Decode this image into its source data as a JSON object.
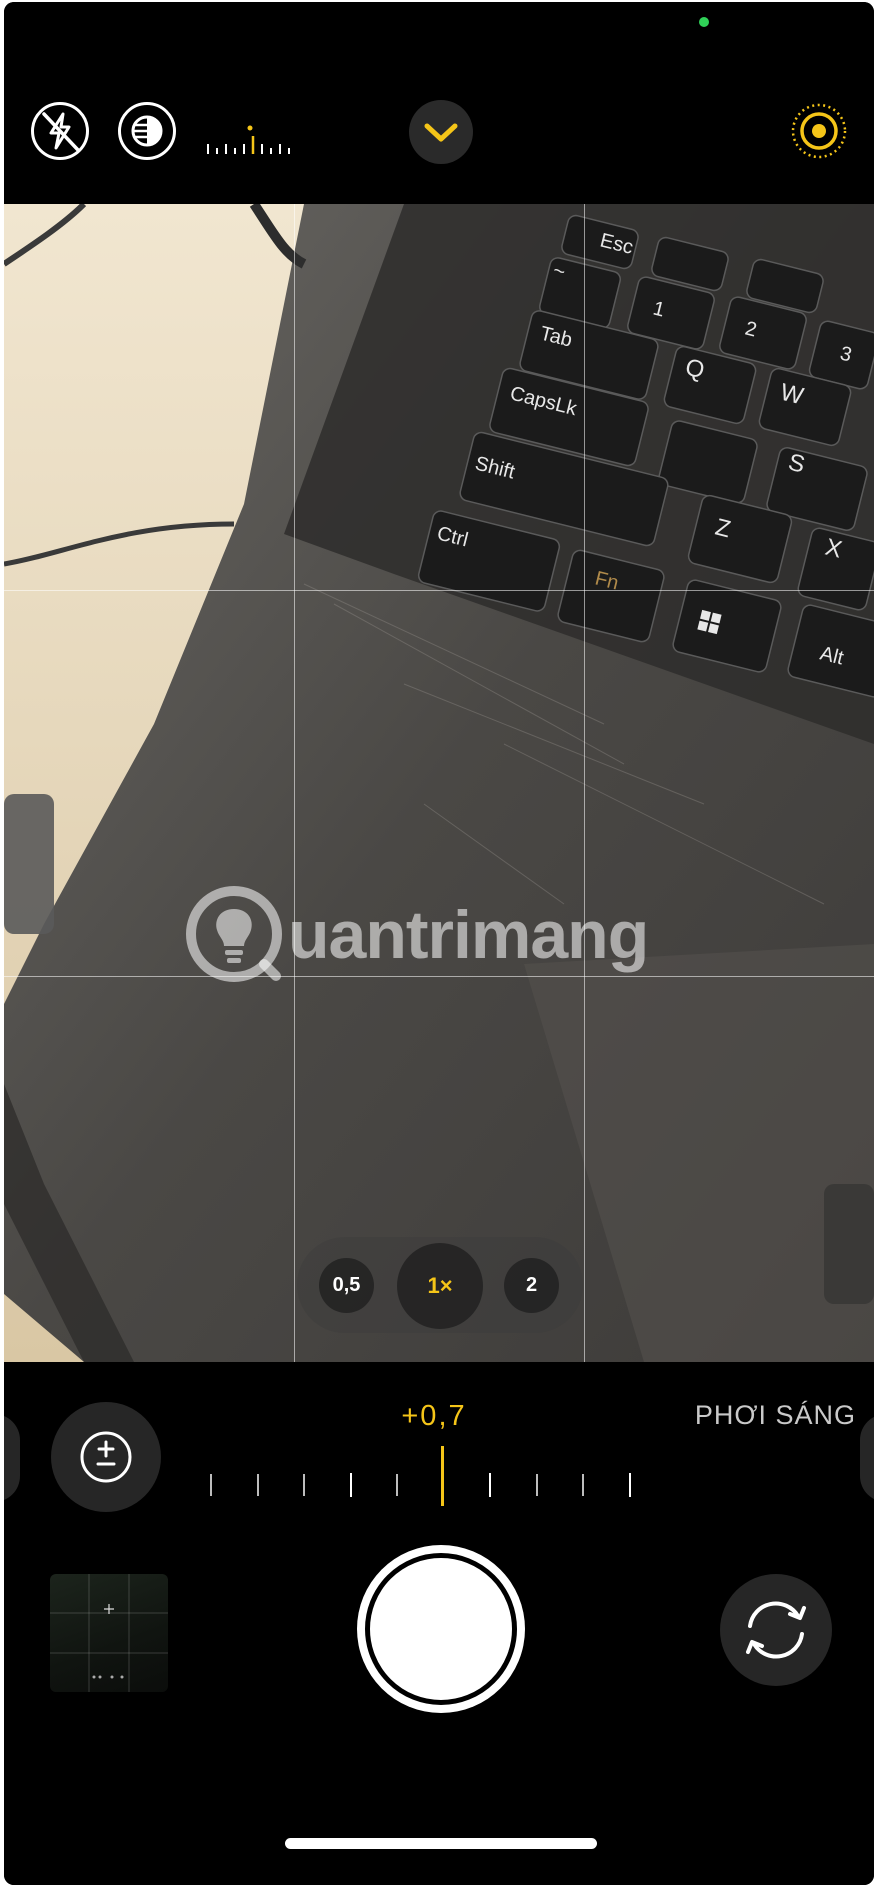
{
  "top_bar": {
    "flash_icon": "flash-off-icon",
    "night_icon": "night-mode-icon",
    "chevron_icon": "chevron-down-icon",
    "live_icon": "live-photo-icon",
    "accent_color": "#f5c518"
  },
  "viewfinder": {
    "watermark_text": "uantrimang",
    "zoom": {
      "options": [
        "0,5",
        "1×",
        "2"
      ],
      "selected": "1×"
    },
    "keyboard_keys": [
      "Esc",
      "~",
      "1",
      "Tab",
      "Q",
      "CapsLk",
      "W",
      "Shift",
      "S",
      "Ctrl",
      "Fn",
      "Z",
      "X",
      "Alt",
      "2",
      "3"
    ]
  },
  "exposure": {
    "value": "+0,7",
    "label": "PHƠI SÁNG",
    "icon": "exposure-compensation-icon"
  },
  "bottom": {
    "shutter_icon": "shutter-button",
    "flip_icon": "camera-flip-icon",
    "thumbnail_icon": "last-photo-thumbnail"
  }
}
